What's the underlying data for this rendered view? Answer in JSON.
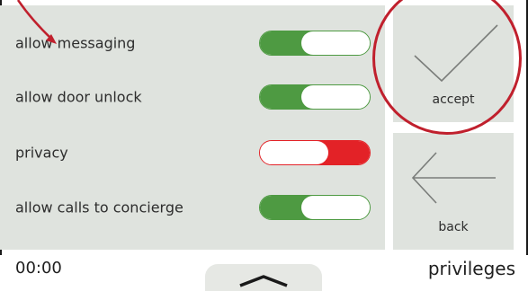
{
  "settings": [
    {
      "label": "allow messaging",
      "state": "on"
    },
    {
      "label": "allow door unlock",
      "state": "on"
    },
    {
      "label": "privacy",
      "state": "off"
    },
    {
      "label": "allow calls to concierge",
      "state": "on"
    }
  ],
  "actions": {
    "accept_label": "accept",
    "accept_icon": "checkmark-icon",
    "back_label": "back",
    "back_icon": "arrow-left-icon"
  },
  "footer": {
    "time": "00:00",
    "title": "privileges",
    "drawer_icon": "chevron-up-icon"
  },
  "colors": {
    "panel": "#dfe3de",
    "toggle_on": "#4e9a42",
    "toggle_off": "#e32227",
    "annotation": "#c0202d",
    "text": "#2d2d2d"
  }
}
